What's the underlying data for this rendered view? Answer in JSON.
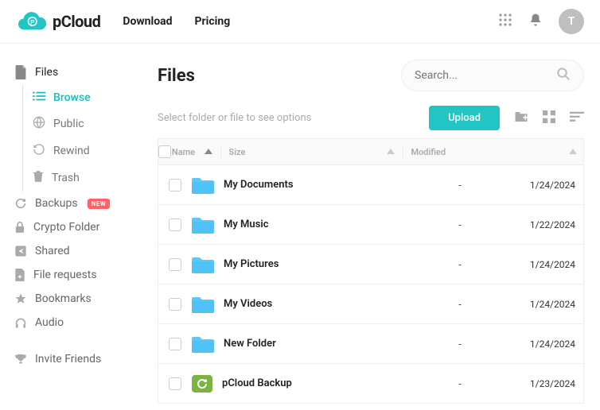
{
  "header": {
    "brand": "pCloud",
    "nav": {
      "download": "Download",
      "pricing": "Pricing"
    },
    "avatar_initial": "T"
  },
  "sidebar": {
    "files": "Files",
    "browse": "Browse",
    "public": "Public",
    "rewind": "Rewind",
    "trash": "Trash",
    "backups": "Backups",
    "backups_badge": "NEW",
    "crypto": "Crypto Folder",
    "shared": "Shared",
    "file_requests": "File requests",
    "bookmarks": "Bookmarks",
    "audio": "Audio",
    "invite": "Invite Friends"
  },
  "main": {
    "title": "Files",
    "search_placeholder": "Search...",
    "hint": "Select folder or file to see options",
    "upload_label": "Upload",
    "columns": {
      "name": "Name",
      "size": "Size",
      "modified": "Modified"
    }
  },
  "rows": [
    {
      "name": "My Documents",
      "size": "-",
      "modified": "1/24/2024",
      "type": "folder-blue"
    },
    {
      "name": "My Music",
      "size": "-",
      "modified": "1/22/2024",
      "type": "folder-blue"
    },
    {
      "name": "My Pictures",
      "size": "-",
      "modified": "1/24/2024",
      "type": "folder-blue"
    },
    {
      "name": "My Videos",
      "size": "-",
      "modified": "1/24/2024",
      "type": "folder-blue"
    },
    {
      "name": "New Folder",
      "size": "-",
      "modified": "1/24/2024",
      "type": "folder-blue"
    },
    {
      "name": "pCloud Backup",
      "size": "-",
      "modified": "1/23/2024",
      "type": "backup-green"
    }
  ]
}
